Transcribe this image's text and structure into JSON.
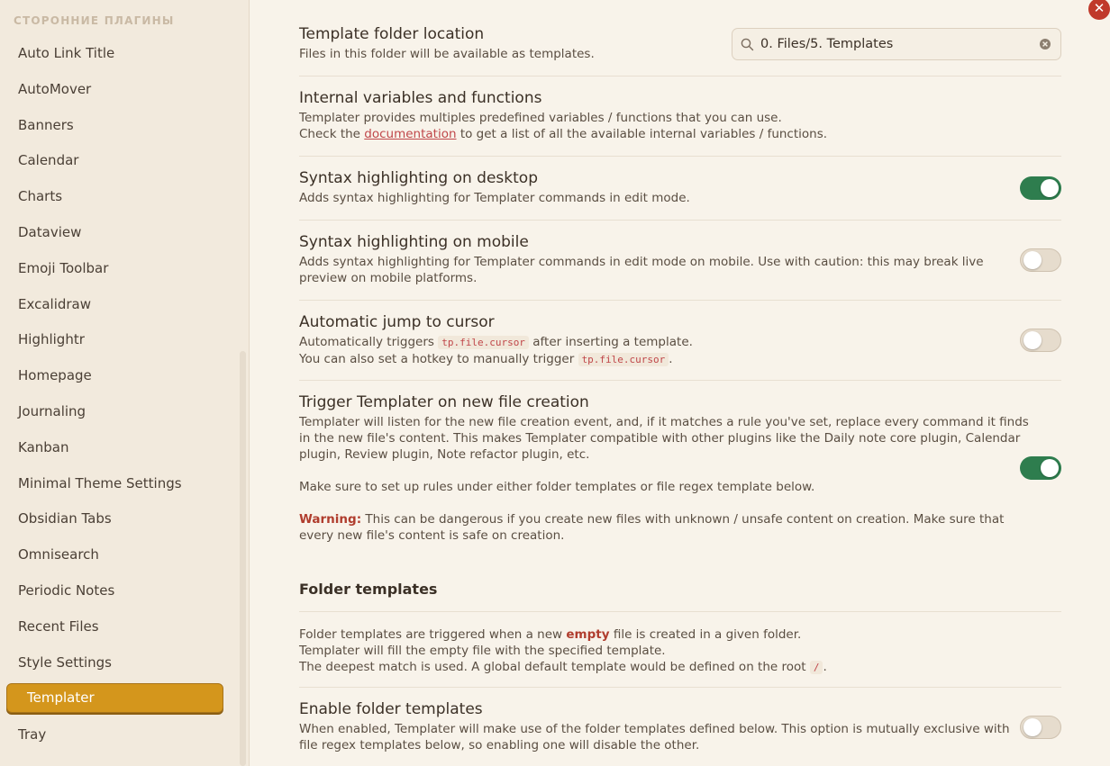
{
  "sidebar": {
    "heading": "СТОРОННИЕ ПЛАГИНЫ",
    "items": [
      {
        "label": "Auto Link Title"
      },
      {
        "label": "AutoMover"
      },
      {
        "label": "Banners"
      },
      {
        "label": "Calendar"
      },
      {
        "label": "Charts"
      },
      {
        "label": "Dataview"
      },
      {
        "label": "Emoji Toolbar"
      },
      {
        "label": "Excalidraw"
      },
      {
        "label": "Highlightr"
      },
      {
        "label": "Homepage"
      },
      {
        "label": "Journaling"
      },
      {
        "label": "Kanban"
      },
      {
        "label": "Minimal Theme Settings"
      },
      {
        "label": "Obsidian Tabs"
      },
      {
        "label": "Omnisearch"
      },
      {
        "label": "Periodic Notes"
      },
      {
        "label": "Recent Files"
      },
      {
        "label": "Style Settings"
      }
    ],
    "active_item": "Templater",
    "after_item": "Tray"
  },
  "close_glyph": "✕",
  "settings": {
    "template_folder": {
      "title": "Template folder location",
      "desc": "Files in this folder will be available as templates.",
      "value": "0. Files/5. Templates"
    },
    "internal_vars": {
      "title": "Internal variables and functions",
      "desc1": "Templater provides multiples predefined variables / functions that you can use.",
      "desc2_pre": "Check the",
      "desc2_link": "documentation",
      "desc2_post": "to get a list of all the available internal variables / functions."
    },
    "syntax_desktop": {
      "title": "Syntax highlighting on desktop",
      "desc": "Adds syntax highlighting for Templater commands in edit mode.",
      "enabled": true
    },
    "syntax_mobile": {
      "title": "Syntax highlighting on mobile",
      "desc1": "Adds syntax highlighting for Templater commands in edit mode on mobile. Use with caution: this may break live",
      "desc2": "preview on mobile platforms.",
      "enabled": false
    },
    "jump_cursor": {
      "title": "Automatic jump to cursor",
      "desc1_pre": "Automatically triggers",
      "code": "tp.file.cursor",
      "desc1_post": "after inserting a template.",
      "desc2_pre": "You can also set a hotkey to manually trigger",
      "desc2_post": ".",
      "enabled": false
    },
    "trigger_new_file": {
      "title": "Trigger Templater on new file creation",
      "desc1": "Templater will listen for the new file creation event, and, if it matches a rule you've set, replace every command it finds",
      "desc2": "in the new file's content. This makes Templater compatible with other plugins like the Daily note core plugin, Calendar",
      "desc3": "plugin, Review plugin, Note refactor plugin, etc.",
      "desc4": "Make sure to set up rules under either folder templates or file regex template below.",
      "warning_label": "Warning:",
      "warning1": "This can be dangerous if you create new files with unknown / unsafe content on creation. Make sure that",
      "warning2": "every new file's content is safe on creation.",
      "enabled": true
    },
    "folder_templates_heading": "Folder templates",
    "folder_templates_info": {
      "line1_pre": "Folder templates are triggered when a new",
      "line1_em": "empty",
      "line1_post": "file is created in a given folder.",
      "line2": "Templater will fill the empty file with the specified template.",
      "line3_pre": "The deepest match is used. A global default template would be defined on the root",
      "line3_code": "/",
      "line3_post": "."
    },
    "enable_folder_templates": {
      "title": "Enable folder templates",
      "desc1": "When enabled, Templater will make use of the folder templates defined below. This option is mutually exclusive with",
      "desc2": "file regex templates below, so enabling one will disable the other.",
      "enabled": false
    }
  }
}
